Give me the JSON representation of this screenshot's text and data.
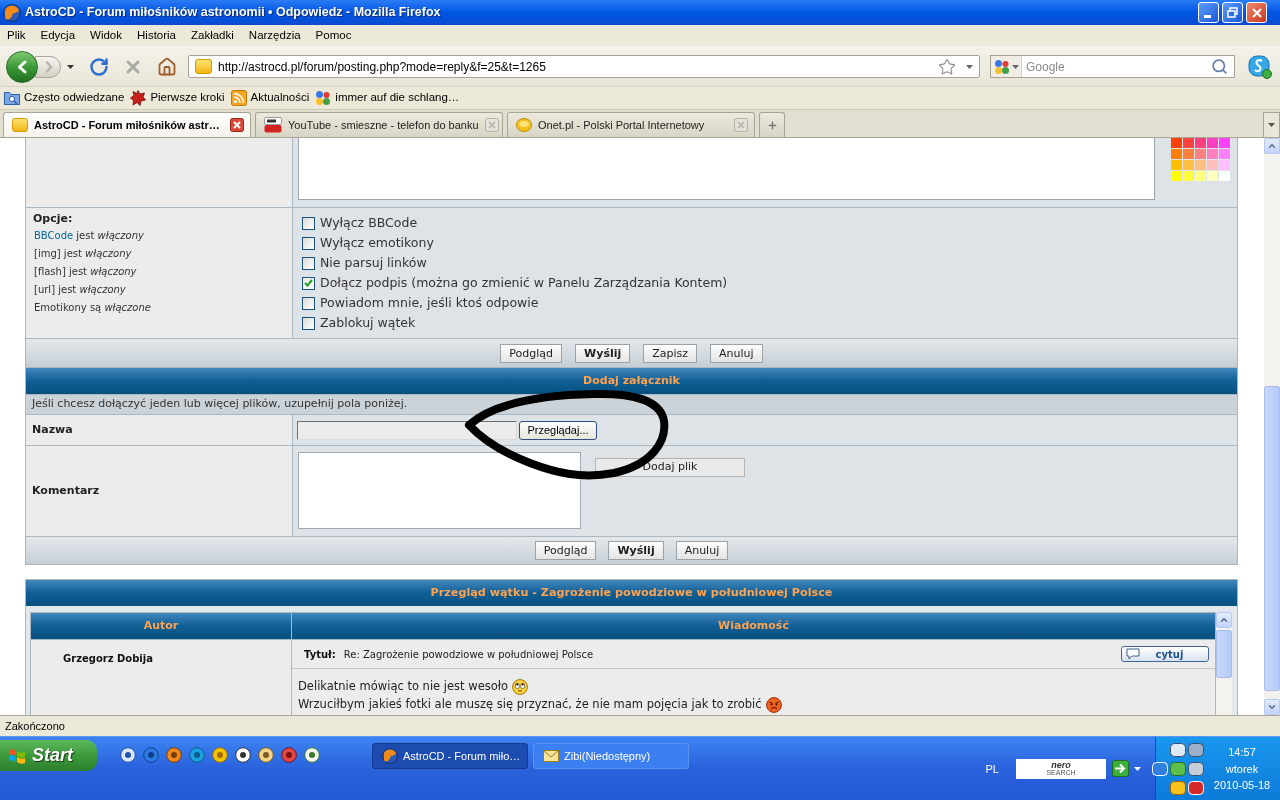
{
  "window": {
    "title": "AstroCD - Forum miłośników astronomii • Odpowiedz - Mozilla Firefox"
  },
  "menu": [
    "Plik",
    "Edycja",
    "Widok",
    "Historia",
    "Zakładki",
    "Narzędzia",
    "Pomoc"
  ],
  "address_bar": {
    "url": "http://astrocd.pl/forum/posting.php?mode=reply&f=25&t=1265"
  },
  "search": {
    "placeholder": "Google"
  },
  "bookmarks": [
    {
      "label": "Często odwiedzane",
      "kind": "folder"
    },
    {
      "label": "Pierwsze kroki",
      "kind": "start"
    },
    {
      "label": "Aktualności",
      "kind": "feed"
    },
    {
      "label": "immer auf die schlang…",
      "kind": "google"
    }
  ],
  "tabs": [
    {
      "label": "AstroCD - Forum miłośników astr…",
      "selected": true,
      "kind": "forum"
    },
    {
      "label": "YouTube - smieszne - telefon do banku",
      "selected": false,
      "kind": "video"
    },
    {
      "label": "Onet.pl - Polski Portal Internetowy",
      "selected": false,
      "kind": "portal"
    }
  ],
  "editor": {
    "palette": [
      {
        "color": "#ff4000"
      },
      {
        "color": "#ff4040"
      },
      {
        "color": "#ff4080"
      },
      {
        "color": "#ff40bf"
      },
      {
        "color": "#ff40ff"
      },
      {
        "color": "#ff8000"
      },
      {
        "color": "#ff8040"
      },
      {
        "color": "#ff8080"
      },
      {
        "color": "#ff80bf"
      },
      {
        "color": "#ff80ff"
      },
      {
        "color": "#ffbf00"
      },
      {
        "color": "#ffbf40"
      },
      {
        "color": "#ffbf80"
      },
      {
        "color": "#ffbfbf"
      },
      {
        "color": "#ffbfff"
      },
      {
        "color": "#ffff00"
      },
      {
        "color": "#ffff40"
      },
      {
        "color": "#ffff80"
      },
      {
        "color": "#ffffbf"
      },
      {
        "color": "#ffffff"
      }
    ]
  },
  "options": {
    "title": "Opcje:",
    "status": [
      {
        "tag": "BBCode",
        "link": true,
        "text": "jest *włączony*"
      },
      {
        "tag": "[img]",
        "link": false,
        "text": "jest *włączony*"
      },
      {
        "tag": "[flash]",
        "link": false,
        "text": "jest *włączony*"
      },
      {
        "tag": "[url]",
        "link": false,
        "text": "jest *włączony*"
      },
      {
        "tag": "Emotikony",
        "link": false,
        "text": "są *włączone*"
      }
    ],
    "checkboxes": [
      {
        "label": "Wyłącz BBCode",
        "checked": false
      },
      {
        "label": "Wyłącz emotikony",
        "checked": false
      },
      {
        "label": "Nie parsuj linków",
        "checked": false
      },
      {
        "label": "Dołącz podpis (można go zmienić w Panelu Zarządzania Kontem)",
        "checked": true
      },
      {
        "label": "Powiadom mnie, jeśli ktoś odpowie",
        "checked": false
      },
      {
        "label": "Zablokuj wątek",
        "checked": false
      }
    ]
  },
  "post_buttons": [
    {
      "label": "Podgląd",
      "primary": false
    },
    {
      "label": "Wyślij",
      "primary": true
    },
    {
      "label": "Zapisz",
      "primary": false
    },
    {
      "label": "Anuluj",
      "primary": false
    }
  ],
  "attachment": {
    "title": "Dodaj załącznik",
    "hint": "Jeśli chcesz dołączyć jeden lub więcej plików, uzupełnij pola poniżej.",
    "name_label": "Nazwa",
    "browse_button": "Przeglądaj...",
    "comment_label": "Komentarz",
    "add_button": "Dodaj plik",
    "buttons": [
      {
        "label": "Podgląd",
        "primary": false
      },
      {
        "label": "Wyślij",
        "primary": true
      },
      {
        "label": "Anuluj",
        "primary": false
      }
    ]
  },
  "review": {
    "title": "Przegląd wątku - Zagrożenie powodziowe w południowej Polsce",
    "columns": [
      "Autor",
      "Wiadomość"
    ],
    "posts": [
      {
        "author": "Grzegorz Dobija",
        "subject_label": "Tytuł:",
        "subject": "Re: Zagrożenie powodziowe w południowej Polsce",
        "quote_button": "cytuj",
        "lines": [
          {
            "text": "Delikatnie mówiąc to nie jest wesoło",
            "kind": "rolleyes"
          },
          {
            "text": "Wrzuciłbym jakieś fotki ale muszę się przyznać, że nie mam pojęcia jak to zrobić",
            "kind": "mad"
          }
        ]
      }
    ]
  },
  "status_bar": {
    "text": "Zakończono"
  },
  "taskbar": {
    "start": "Start",
    "tasks": [
      {
        "label": "AstroCD - Forum miło…",
        "selected": true,
        "kind": "browser"
      },
      {
        "label": "Zibi(Niedostępny)",
        "selected": false,
        "kind": "mail"
      }
    ],
    "language": "PL",
    "search_logo": [
      "nero",
      "SEARCH"
    ],
    "clock": {
      "time": "14:57",
      "day": "wtorek",
      "date": "2010-05-18"
    }
  }
}
